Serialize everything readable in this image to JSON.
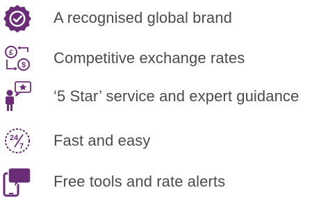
{
  "colors": {
    "brand_purple": "#6b2c77",
    "text_gray": "#4a4a4a"
  },
  "features": [
    {
      "icon": "verified-badge-icon",
      "label": "A recognised global brand"
    },
    {
      "icon": "currency-exchange-icon",
      "label": "Competitive exchange rates"
    },
    {
      "icon": "star-service-icon",
      "label": "‘5 Star’ service and expert guidance"
    },
    {
      "icon": "24-7-icon",
      "label": "Fast and easy"
    },
    {
      "icon": "mobile-chat-icon",
      "label": "Free tools and rate alerts"
    }
  ]
}
